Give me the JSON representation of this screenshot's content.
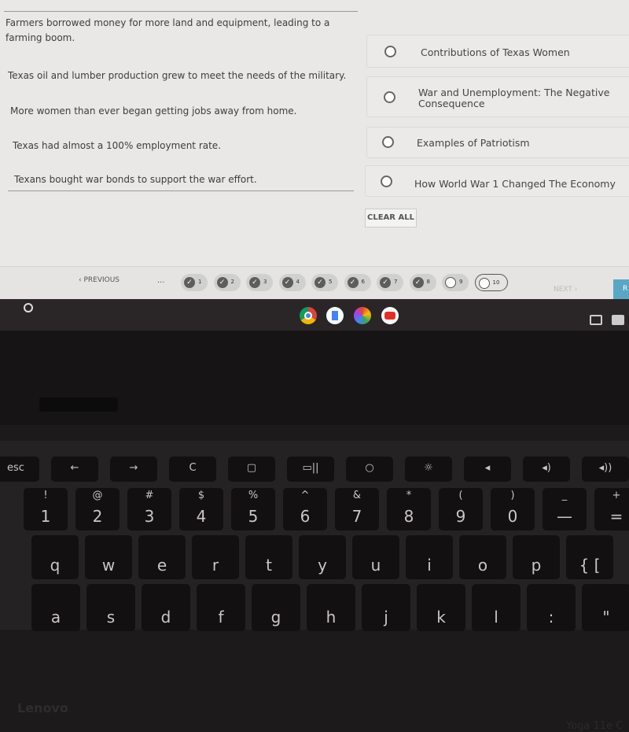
{
  "statements": [
    "Farmers borrowed money for more land and equipment, leading to a farming boom.",
    "Texas oil and lumber production grew to meet the needs of the military.",
    "More women than ever began getting jobs away from home.",
    "Texas had almost a 100% employment rate.",
    "Texans bought war bonds to support the war effort."
  ],
  "options": [
    {
      "label": "Contributions of Texas Women",
      "selected": false
    },
    {
      "label": "War and Unemployment: The Negative Consequence",
      "selected": false
    },
    {
      "label": "Examples of Patriotism",
      "selected": false
    },
    {
      "label": "How World War 1 Changed The Economy",
      "selected": false
    }
  ],
  "clear_all": "CLEAR ALL",
  "nav": {
    "previous": "‹ PREVIOUS",
    "ellipsis": "...",
    "next": "NEXT ›",
    "review_partial": "R",
    "pages": [
      {
        "n": "1",
        "done": true
      },
      {
        "n": "2",
        "done": true
      },
      {
        "n": "3",
        "done": true
      },
      {
        "n": "4",
        "done": true
      },
      {
        "n": "5",
        "done": true
      },
      {
        "n": "6",
        "done": true
      },
      {
        "n": "7",
        "done": true
      },
      {
        "n": "8",
        "done": true
      },
      {
        "n": "9",
        "done": false
      },
      {
        "n": "10",
        "done": false,
        "current": true
      }
    ]
  },
  "shelf": {
    "launcher": "○",
    "apps": [
      "chrome-icon",
      "docs-icon",
      "photos-icon",
      "youtube-icon"
    ]
  },
  "laptop": {
    "brand": "Lenovo",
    "model": "Yoga 11e C"
  },
  "keyboard": {
    "fn": [
      "esc",
      "←",
      "→",
      "C",
      "▢",
      "▭||",
      "○",
      "☼",
      "◂",
      "◂)",
      "◂))"
    ],
    "numbers": [
      [
        "!",
        "1"
      ],
      [
        "@",
        "2"
      ],
      [
        "#",
        "3"
      ],
      [
        "$",
        "4"
      ],
      [
        "%",
        "5"
      ],
      [
        "^",
        "6"
      ],
      [
        "&",
        "7"
      ],
      [
        "*",
        "8"
      ],
      [
        "(",
        "9"
      ],
      [
        ")",
        "0"
      ],
      [
        "_",
        "—"
      ],
      [
        "+",
        "="
      ]
    ],
    "row_q": [
      "q",
      "w",
      "e",
      "r",
      "t",
      "y",
      "u",
      "i",
      "o",
      "p",
      "{ ["
    ],
    "row_a": [
      "a",
      "s",
      "d",
      "f",
      "g",
      "h",
      "j",
      "k",
      "l",
      ":",
      "\""
    ]
  }
}
